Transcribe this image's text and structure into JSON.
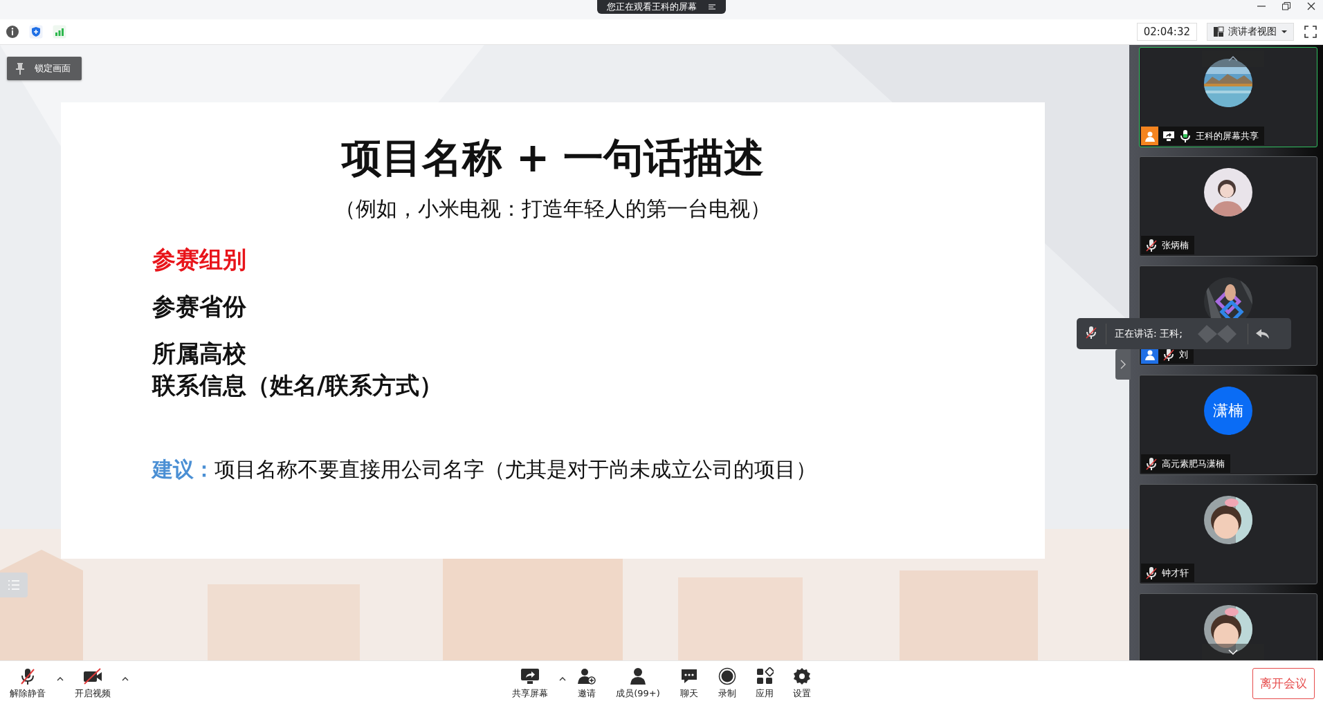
{
  "banner": {
    "text": "您正在观看王科的屏幕"
  },
  "toolbar": {
    "timer": "02:04:32",
    "view_menu": "演讲者视图"
  },
  "lock_button": {
    "label": "锁定画面"
  },
  "slide": {
    "title": "项目名称 + 一句话描述",
    "subtitle": "（例如，小米电视：打造年轻人的第一台电视）",
    "groups": [
      {
        "items": [
          {
            "text": "参赛组别",
            "highlight": true
          }
        ]
      },
      {
        "items": [
          {
            "text": "参赛省份",
            "highlight": false
          }
        ]
      },
      {
        "items": [
          {
            "text": "所属高校",
            "highlight": false
          },
          {
            "text": "联系信息（姓名/联系方式）",
            "highlight": false
          }
        ]
      }
    ],
    "tip_label": "建议：",
    "tip_text": "项目名称不要直接用公司名字（尤其是对于尚未成立公司的项目）"
  },
  "participants": [
    {
      "kind": "picture",
      "name": "王科的屏幕共享",
      "muted": false,
      "sharing": true,
      "selected": true,
      "color": "#f5841f"
    },
    {
      "kind": "picture",
      "name": "张炳楠",
      "muted": true,
      "sharing": false,
      "selected": false
    },
    {
      "kind": "picture",
      "name": "刘",
      "muted": true,
      "sharing": false,
      "selected": false,
      "color": "#1f6fe5"
    },
    {
      "kind": "initials",
      "initials": "潇楠",
      "name": "高元素肥马潇楠",
      "muted": true,
      "sharing": false,
      "selected": false
    },
    {
      "kind": "picture",
      "name": "钟才轩",
      "muted": true,
      "sharing": false,
      "selected": false
    },
    {
      "kind": "picture",
      "selected": false
    }
  ],
  "speaking": {
    "text": "正在讲话: 王科;"
  },
  "controls": [
    {
      "kind": "mic",
      "label": "解除静音",
      "off": true,
      "caret": true
    },
    {
      "kind": "video",
      "label": "开启视频",
      "off": true,
      "caret": true
    },
    {
      "kind": "share",
      "label": "共享屏幕",
      "caret": true
    },
    {
      "kind": "invite",
      "label": "邀请"
    },
    {
      "kind": "members",
      "label": "成员(99+)"
    },
    {
      "kind": "chat",
      "label": "聊天"
    },
    {
      "kind": "record",
      "label": "录制"
    },
    {
      "kind": "apps",
      "label": "应用"
    },
    {
      "kind": "settings",
      "label": "设置"
    }
  ],
  "leave_button": {
    "label": "离开会议"
  }
}
